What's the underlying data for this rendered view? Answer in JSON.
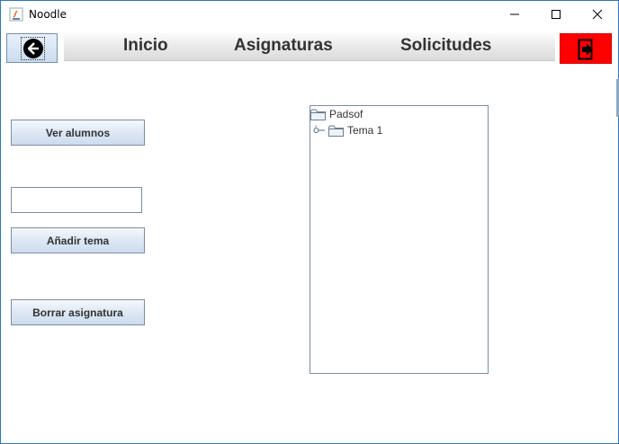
{
  "window": {
    "title": "Noodle",
    "controls": {
      "minimize": "minimize",
      "maximize": "maximize",
      "close": "close"
    }
  },
  "nav": {
    "back_icon": "arrow-left-circle-icon",
    "items": [
      {
        "label": "Inicio"
      },
      {
        "label": "Asignaturas"
      },
      {
        "label": "Solicitudes"
      }
    ],
    "exit_icon": "exit-door-icon",
    "exit_color": "#ff0000"
  },
  "actions": {
    "view_students": "Ver alumnos",
    "topic_input_value": "",
    "add_topic": "Añadir tema",
    "delete_subject": "Borrar asignatura"
  },
  "tree": {
    "root": {
      "label": "Padsof",
      "icon": "folder-icon"
    },
    "children": [
      {
        "label": "Tema 1",
        "icon": "folder-icon",
        "handle_icon": "tree-expand-handle-icon"
      }
    ]
  }
}
